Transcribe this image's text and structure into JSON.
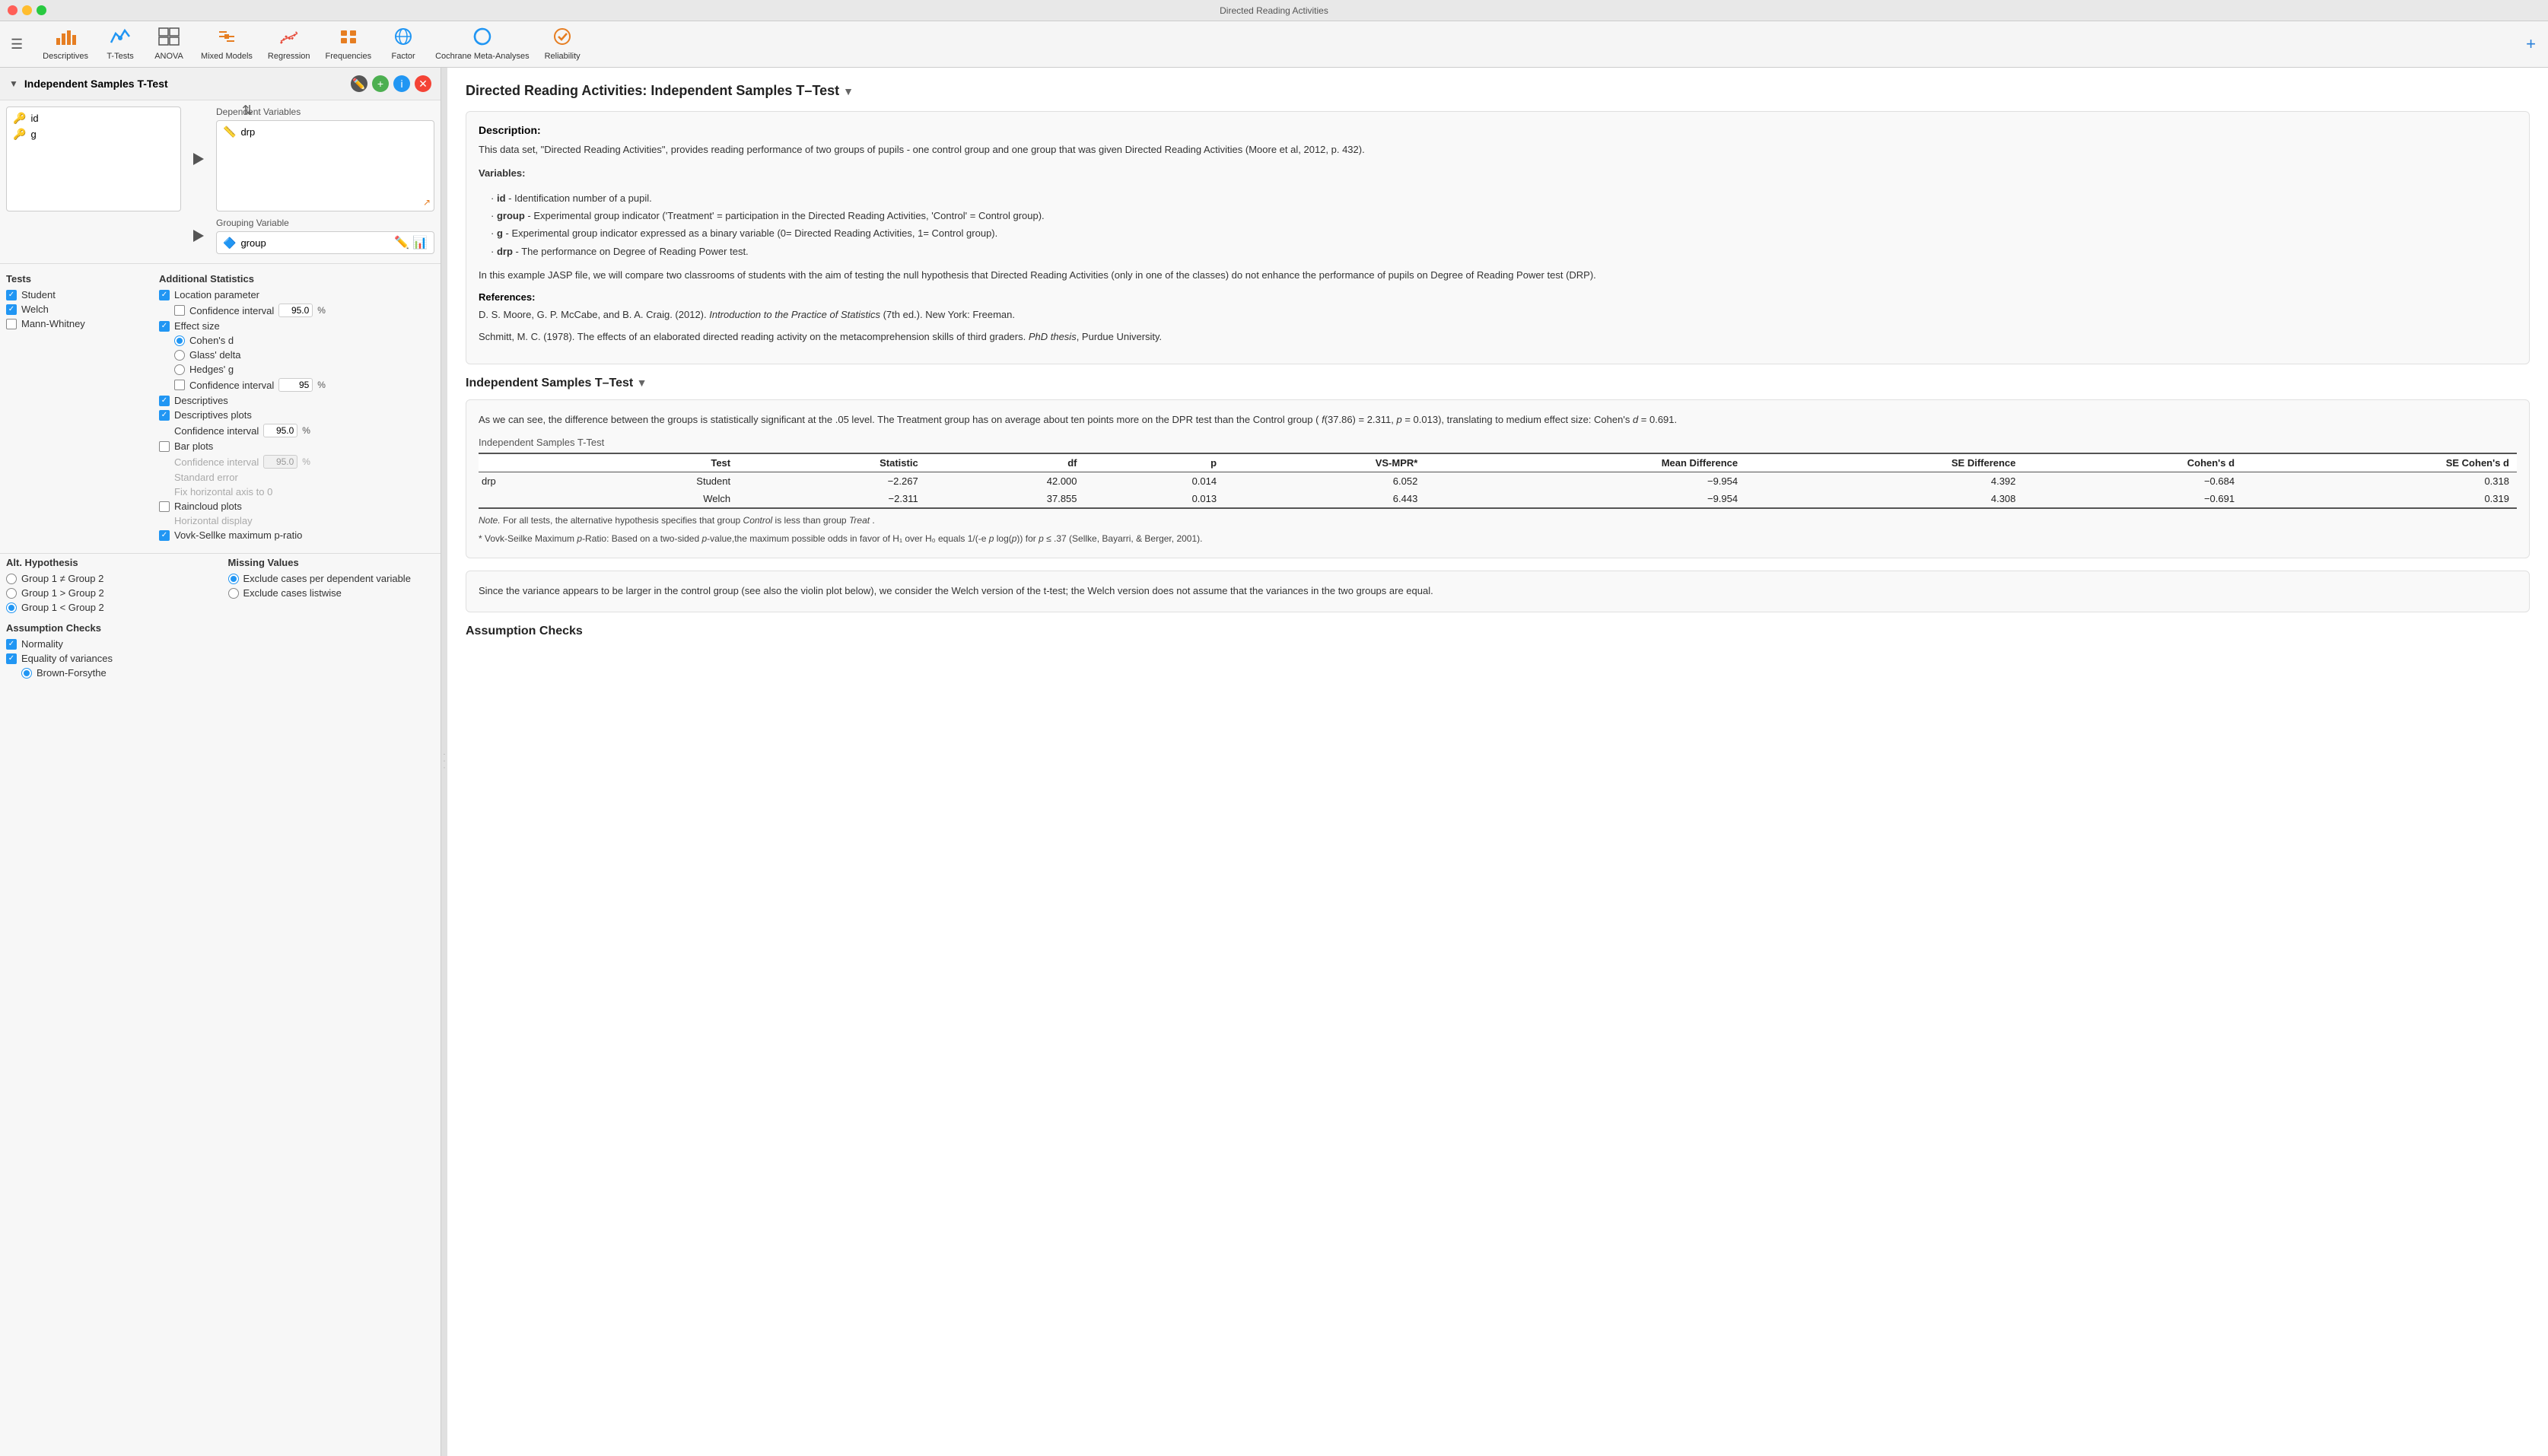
{
  "titlebar": {
    "title": "Directed Reading Activities"
  },
  "toolbar": {
    "items": [
      {
        "id": "descriptives",
        "label": "Descriptives",
        "icon": "📊"
      },
      {
        "id": "t-tests",
        "label": "T-Tests",
        "icon": "📈"
      },
      {
        "id": "anova",
        "label": "ANOVA",
        "icon": "📉"
      },
      {
        "id": "mixed-models",
        "label": "Mixed Models",
        "icon": "🔀"
      },
      {
        "id": "regression",
        "label": "Regression",
        "icon": "📐"
      },
      {
        "id": "frequencies",
        "label": "Frequencies",
        "icon": "📋"
      },
      {
        "id": "factor",
        "label": "Factor",
        "icon": "🔲"
      },
      {
        "id": "cochrane",
        "label": "Cochrane Meta-Analyses",
        "icon": "⚙️"
      },
      {
        "id": "reliability",
        "label": "Reliability",
        "icon": "🎯"
      }
    ],
    "plus_label": "+"
  },
  "left_panel": {
    "title": "Independent Samples T-Test",
    "variables": [
      "id",
      "g"
    ],
    "dependent_variable": "drp",
    "grouping_variable": "group",
    "tests": {
      "title": "Tests",
      "student": {
        "label": "Student",
        "checked": true
      },
      "welch": {
        "label": "Welch",
        "checked": true
      },
      "mann_whitney": {
        "label": "Mann-Whitney",
        "checked": false
      }
    },
    "additional_stats": {
      "title": "Additional Statistics",
      "location_parameter": {
        "label": "Location parameter",
        "checked": true
      },
      "confidence_interval": {
        "label": "Confidence interval",
        "checked": false,
        "value": "95.0",
        "unit": "%"
      },
      "effect_size": {
        "label": "Effect size",
        "checked": true
      },
      "cohens_d": {
        "label": "Cohen's d",
        "selected": true
      },
      "glass_delta": {
        "label": "Glass' delta",
        "selected": false
      },
      "hedges_g": {
        "label": "Hedges' g",
        "selected": false
      },
      "ci_effect": {
        "label": "Confidence interval",
        "checked": false,
        "value": "95",
        "unit": "%"
      },
      "descriptives": {
        "label": "Descriptives",
        "checked": true
      },
      "descriptives_plots": {
        "label": "Descriptives plots",
        "checked": true
      },
      "desc_ci": {
        "label": "Confidence interval",
        "value": "95.0",
        "unit": "%"
      },
      "bar_plots": {
        "label": "Bar plots",
        "checked": false
      },
      "bar_ci": {
        "label": "Confidence interval",
        "value": "95.0",
        "unit": "%",
        "disabled": true
      },
      "std_error": {
        "label": "Standard error",
        "disabled": true
      },
      "fix_horiz": {
        "label": "Fix horizontal axis to 0",
        "disabled": true
      },
      "raincloud_plots": {
        "label": "Raincloud plots",
        "checked": false
      },
      "horiz_display": {
        "label": "Horizontal display",
        "disabled": true
      },
      "vovk": {
        "label": "Vovk-Sellke maximum p-ratio",
        "checked": true
      }
    },
    "alt_hypothesis": {
      "title": "Alt. Hypothesis",
      "options": [
        {
          "label": "Group 1 ≠ Group 2",
          "selected": false
        },
        {
          "label": "Group 1 > Group 2",
          "selected": false
        },
        {
          "label": "Group 1 < Group 2",
          "selected": true
        }
      ]
    },
    "assumption_checks": {
      "title": "Assumption Checks",
      "normality": {
        "label": "Normality",
        "checked": true
      },
      "equality_variances": {
        "label": "Equality of variances",
        "checked": true
      },
      "brown_forsythe": {
        "label": "Brown-Forsythe",
        "selected": true
      }
    },
    "missing_values": {
      "title": "Missing Values",
      "exclude_dependent": {
        "label": "Exclude cases per dependent variable",
        "selected": true
      },
      "exclude_listwise": {
        "label": "Exclude cases listwise",
        "selected": false
      }
    }
  },
  "right_panel": {
    "title": "Directed Reading Activities: Independent Samples T–Test",
    "description": {
      "title": "Description:",
      "text": "This data set, \"Directed Reading Activities\", provides reading performance of two groups of pupils - one control group and one group that was given Directed Reading Activities (Moore et al, 2012, p. 432).",
      "variables_title": "Variables:",
      "variables": [
        "id - Identification number of a pupil.",
        "group - Experimental group indicator ('Treatment' = participation in the Directed Reading Activities, 'Control' = Control group).",
        "g - Experimental group indicator expressed as a binary variable (0= Directed Reading Activities, 1= Control group).",
        "drp - The performance on Degree of Reading Power test."
      ],
      "example_text": "In this example JASP file, we will compare two classrooms of students with the aim of testing the null hypothesis that Directed Reading Activities (only in one of the classes) do not enhance the performance of pupils on Degree of Reading Power test (DRP).",
      "references_title": "References:",
      "ref1": "D. S. Moore, G. P. McCabe, and B. A. Craig. (2012). Introduction to the Practice of Statistics (7th ed.). New York: Freeman.",
      "ref2": "Schmitt, M. C. (1978). The effects of an elaborated directed reading activity on the metacomprehension skills of third graders. PhD thesis, Purdue University."
    },
    "t_test_section": {
      "title": "Independent Samples T–Test",
      "analysis_text": "As we can see, the difference between the groups is statistically significant at the .05 level. The Treatment group has on average about ten points more on the DPR test than the Control group ( f(37.86) = 2.311, p = 0.013), translating to medium effect size: Cohen's d = 0.691.",
      "table_label": "Independent Samples T-Test",
      "table_headers": [
        "",
        "Test",
        "Statistic",
        "df",
        "p",
        "VS-MPR*",
        "Mean Difference",
        "SE Difference",
        "Cohen's d",
        "SE Cohen's d"
      ],
      "table_rows": [
        {
          "var": "drp",
          "test": "Student",
          "statistic": "-2.267",
          "df": "42.000",
          "p": "0.014",
          "vs_mpr": "6.052",
          "mean_diff": "-9.954",
          "se_diff": "4.392",
          "cohens_d": "-0.684",
          "se_cohens_d": "0.318"
        },
        {
          "var": "",
          "test": "Welch",
          "statistic": "-2.311",
          "df": "37.855",
          "p": "0.013",
          "vs_mpr": "6.443",
          "mean_diff": "-9.954",
          "se_diff": "4.308",
          "cohens_d": "-0.691",
          "se_cohens_d": "0.319"
        }
      ],
      "note1": "Note. For all tests, the alternative hypothesis specifies that group Control is less than group Treat .",
      "note2": "* Vovk-Seilke Maximum p-Ratio: Based on a two-sided p-value,the maximum possible odds in favor of H₁ over H₀ equals 1/(-e p log(p)) for p ≤ .37 (Sellke, Bayarri, & Berger, 2001).",
      "assumption_text": "Since the variance appears to be larger in the control group (see also the violin plot below), we consider the Welch version of the t-test; the Welch version does not assume that the variances in the two groups are equal.",
      "assumption_checks_title": "Assumption Checks"
    }
  }
}
